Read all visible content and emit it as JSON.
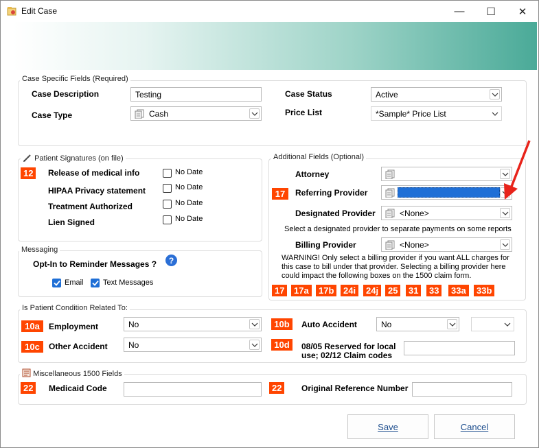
{
  "window": {
    "title": "Edit Case",
    "minimize": "—",
    "maximize": "☐",
    "close": "✕"
  },
  "case_fields": {
    "group_label": "Case Specific Fields (Required)",
    "case_description_label": "Case Description",
    "case_description_value": "Testing",
    "case_type_label": "Case Type",
    "case_type_value": "Cash",
    "case_status_label": "Case Status",
    "case_status_value": "Active",
    "price_list_label": "Price List",
    "price_list_value": "*Sample* Price List"
  },
  "signatures": {
    "group_label": "Patient Signatures (on file)",
    "badge": "12",
    "items": [
      {
        "label": "Release of medical info",
        "check": "No Date"
      },
      {
        "label": "HIPAA Privacy statement",
        "check": "No Date"
      },
      {
        "label": "Treatment Authorized",
        "check": "No Date"
      },
      {
        "label": "Lien Signed",
        "check": "No Date"
      }
    ]
  },
  "messaging": {
    "group_label": "Messaging",
    "opt_in_label": "Opt-In to Reminder Messages ?",
    "help": "?",
    "email_label": "Email",
    "email_checked": true,
    "text_label": "Text Messages",
    "text_checked": true
  },
  "additional": {
    "group_label": "Additional Fields (Optional)",
    "attorney_label": "Attorney",
    "attorney_value": "",
    "referring_badge": "17",
    "referring_label": "Referring Provider",
    "referring_value": "",
    "designated_label": "Designated Provider",
    "designated_value": "<None>",
    "designated_note": "Select a designated provider to separate payments on some reports",
    "billing_label": "Billing Provider",
    "billing_value": "<None>",
    "warning": "WARNING! Only select a billing provider if you want ALL charges for this case to bill under that provider.  Selecting a billing provider here could impact the following boxes on the 1500 claim form.",
    "boxes": [
      "17",
      "17a",
      "17b",
      "24i",
      "24j",
      "25",
      "31",
      "33",
      "33a",
      "33b"
    ]
  },
  "condition": {
    "group_label": "Is Patient Condition Related To:",
    "employment_badge": "10a",
    "employment_label": "Employment",
    "employment_value": "No",
    "other_badge": "10c",
    "other_label": "Other Accident",
    "other_value": "No",
    "auto_badge": "10b",
    "auto_label": "Auto Accident",
    "auto_value": "No",
    "auto_state_value": "",
    "reserved_badge": "10d",
    "reserved_label_1": "08/05 Reserved for local",
    "reserved_label_2": "use; 02/12 Claim codes",
    "reserved_value": ""
  },
  "misc": {
    "group_label": "Miscellaneous 1500 Fields",
    "medicaid_badge": "22",
    "medicaid_label": "Medicaid Code",
    "medicaid_value": "",
    "original_badge": "22",
    "original_label": "Original Reference Number",
    "original_value": ""
  },
  "buttons": {
    "save": "Save",
    "cancel": "Cancel"
  },
  "colors": {
    "badge": "#ff4500",
    "selection": "#1f6fd6",
    "arrow": "#e8231a"
  }
}
